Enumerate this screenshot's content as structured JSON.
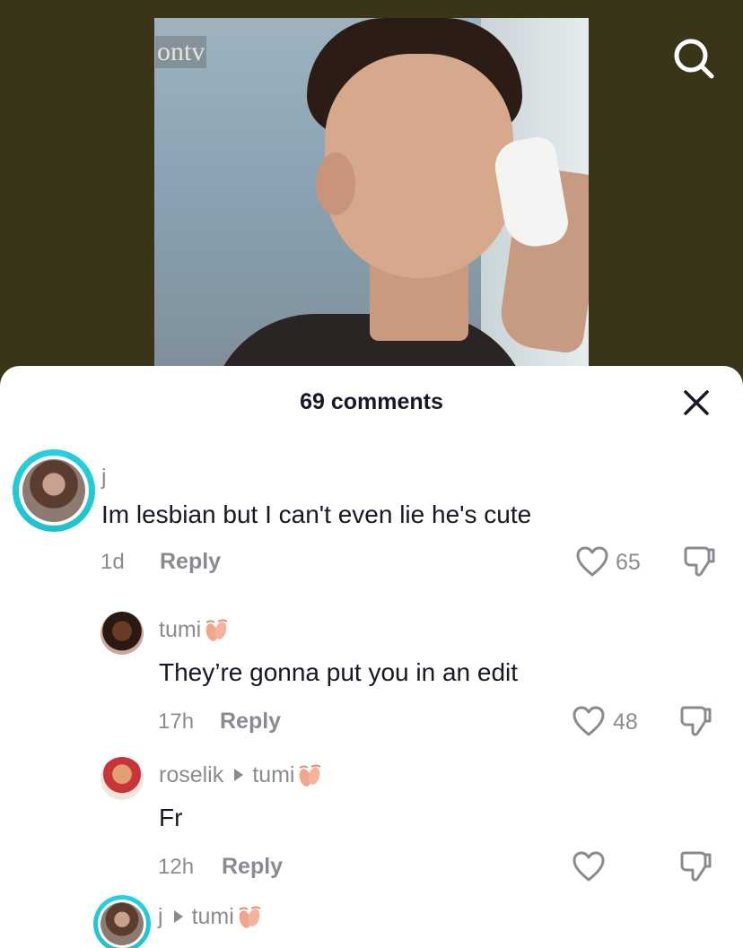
{
  "video": {
    "watermark": "ontv"
  },
  "sheet": {
    "title": "69 comments"
  },
  "comments": [
    {
      "username": "j",
      "text": "Im lesbian but I can't even lie he's cute",
      "time": "1d",
      "reply_label": "Reply",
      "likes": "65"
    },
    {
      "username": "tumi",
      "text": "They’re gonna put you in an edit",
      "time": "17h",
      "reply_label": "Reply",
      "likes": "48"
    },
    {
      "username": "roselik",
      "reply_to": "tumi",
      "text": "Fr",
      "time": "12h",
      "reply_label": "Reply",
      "likes": ""
    },
    {
      "username": "j",
      "reply_to": "tumi"
    }
  ],
  "colors": {
    "background": "#3a3419",
    "sheet": "#ffffff",
    "text_primary": "#161823",
    "text_secondary": "#8a8b91",
    "story_ring": "#25d2e0"
  },
  "icons": {
    "search": "search-icon",
    "close": "close-icon",
    "like": "heart-outline-icon",
    "dislike": "thumbs-down-icon",
    "ballet_shoes": "ballet-shoes-emoji"
  }
}
